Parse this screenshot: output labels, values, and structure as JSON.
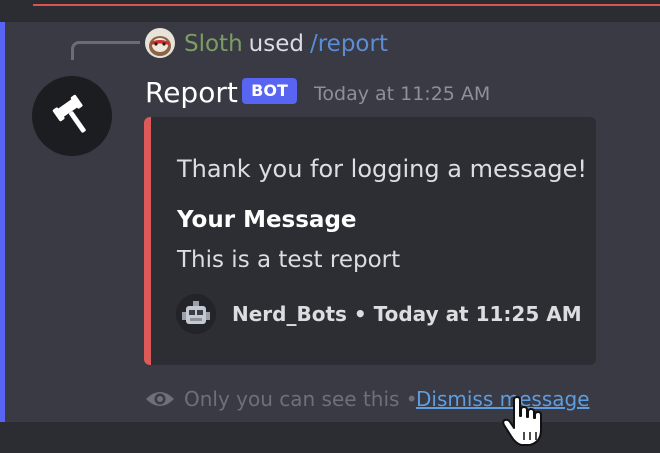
{
  "reply": {
    "username": "Sloth",
    "action": "used",
    "command": "/report"
  },
  "message": {
    "author": "Report",
    "badge": "BOT",
    "timestamp": "Today at 11:25 AM",
    "avatar_icon": "gavel-icon"
  },
  "embed": {
    "accent_color": "#dd5a59",
    "description": "Thank you for logging a message!",
    "field_name": "Your Message",
    "field_value": "This is a test report",
    "footer": "Nerd_Bots • Today at 11:25 AM"
  },
  "ephemeral": {
    "notice": "Only you can see this •",
    "dismiss_label": "Dismiss message"
  },
  "colors": {
    "accent": "#5865f2",
    "link": "#5e9de0",
    "unread_line": "#d9534f"
  }
}
